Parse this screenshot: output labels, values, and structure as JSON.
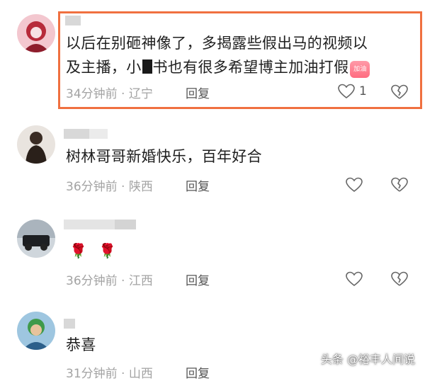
{
  "colors": {
    "highlight": "#f07040",
    "meta_gray": "#a3a3a3"
  },
  "comments": [
    {
      "text_part1": "以后在别砸神像了，多揭露些假出马的视频以",
      "text_part2a": "及主播，小",
      "text_part2b": "书也有很多希望博主加油打假",
      "badge_text": "加油",
      "meta": "34分钟前 · 辽宁",
      "reply": "回复",
      "likes": "1"
    },
    {
      "text": "树林哥哥新婚快乐，百年好合",
      "meta": "36分钟前 · 陕西",
      "reply": "回复"
    },
    {
      "text": "🌹 🌹",
      "meta": "36分钟前 · 江西",
      "reply": "回复"
    },
    {
      "text": "恭喜",
      "meta": "31分钟前 · 山西",
      "reply": "回复"
    }
  ],
  "watermark": "头条 @裕丰人间说",
  "icons": [
    "heart-icon",
    "broken-heart-icon"
  ]
}
